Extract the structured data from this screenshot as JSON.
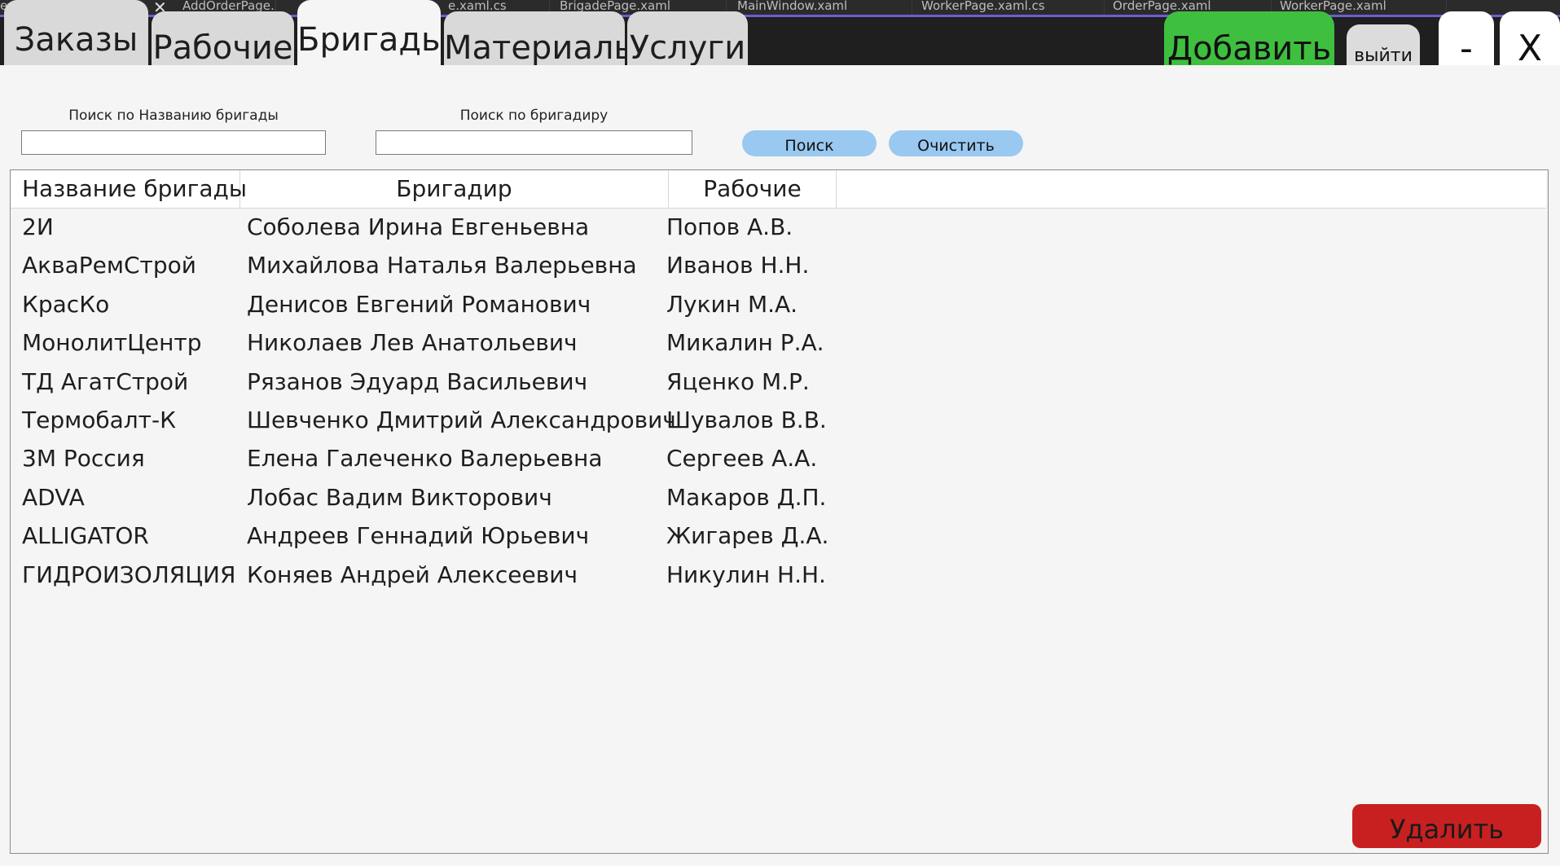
{
  "ide_tabs": [
    "e",
    "AddOrderPage.xaml",
    "e.xaml.cs",
    "BrigadePage.xaml",
    "MainWindow.xaml",
    "WorkerPage.xaml.cs",
    "OrderPage.xaml",
    "WorkerPage.xaml"
  ],
  "tabs": {
    "orders": "Заказы",
    "workers": "Рабочие",
    "brigades": "Бригады",
    "materials": "Материалы",
    "services": "Услуги"
  },
  "header": {
    "add_label": "Добавить",
    "exit_label": "выйти",
    "minimize_label": "-",
    "close_label": "X"
  },
  "search": {
    "name_label": "Поиск по Названию бригады",
    "name_value": "",
    "foreman_label": "Поиск по бригадиру",
    "foreman_value": "",
    "search_button": "Поиск",
    "clear_button": "Очистить"
  },
  "table": {
    "columns": [
      "Название бригады",
      "Бригадир",
      "Рабочие"
    ],
    "rows": [
      [
        "2И",
        "Соболева Ирина Евгеньевна",
        "Попов А.В."
      ],
      [
        "АкваРемСтрой",
        "Михайлова Наталья Валерьевна",
        "Иванов Н.Н."
      ],
      [
        "КрасКо",
        "Денисов Евгений Романович",
        "Лукин М.А."
      ],
      [
        "МонолитЦентр",
        "Николаев Лев Анатольевич",
        "Микалин Р.А."
      ],
      [
        "ТД АгатСтрой",
        "Рязанов Эдуард Васильевич",
        "Яценко М.Р."
      ],
      [
        "Термобалт-К",
        "Шевченко Дмитрий Александрович",
        "Шувалов В.В."
      ],
      [
        "3М Россия",
        "Елена Галеченко Валерьевна",
        "Сергеев А.А."
      ],
      [
        "ADVA",
        "Лобас Вадим Викторович",
        "Макаров Д.П."
      ],
      [
        "ALLIGATOR",
        "Андреев Геннадий Юрьевич",
        "Жигарев Д.А."
      ],
      [
        "ГИДРОИЗОЛЯЦИЯ",
        "Коняев Андрей Алексеевич",
        "Никулин Н.Н."
      ]
    ]
  },
  "footer": {
    "delete_label": "Удалить"
  },
  "colors": {
    "add_button": "#3fbf3f",
    "delete_button": "#c82020",
    "pill_button": "#99c8f0",
    "panel_bg": "#f5f5f5"
  }
}
